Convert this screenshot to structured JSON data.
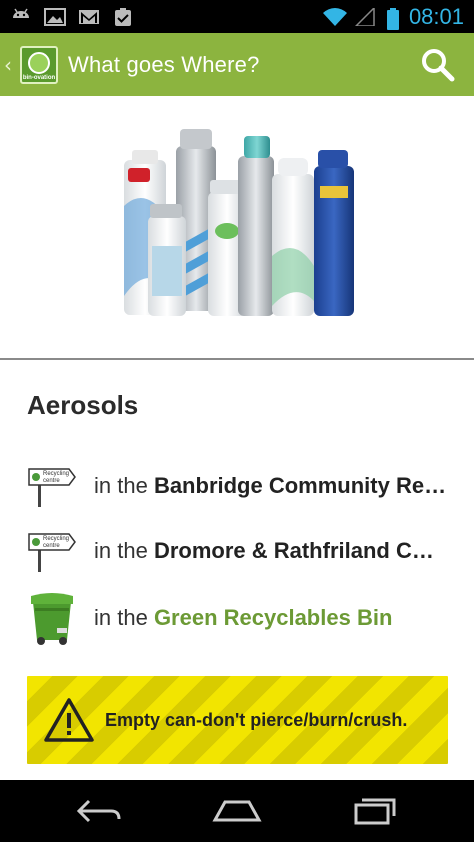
{
  "status_bar": {
    "time": "08:01",
    "icons": [
      "android-icon",
      "image-icon",
      "gmail-icon",
      "clipboard-check-icon",
      "wifi-icon",
      "signal-icon",
      "battery-icon"
    ]
  },
  "action_bar": {
    "title": "What goes Where?",
    "logo_text": "bin-ovation",
    "up_caret": "‹"
  },
  "item": {
    "title": "Aerosols",
    "locations": [
      {
        "icon": "recycling-centre-sign-icon",
        "sign_text": "Recycling centre",
        "prefix": "in the ",
        "name": "Banbridge Community Re…"
      },
      {
        "icon": "recycling-centre-sign-icon",
        "sign_text": "Recycling centre",
        "prefix": "in the ",
        "name": "Dromore & Rathfriland C…"
      },
      {
        "icon": "green-bin-icon",
        "prefix": "in the ",
        "name": "Green Recyclables Bin"
      }
    ],
    "warning": "Empty can-don't pierce/burn/crush."
  },
  "colors": {
    "action_bar": "#8cb43f",
    "green_link": "#6c9a35",
    "time": "#33b5e5",
    "warning_yellow": "#f2e500"
  }
}
